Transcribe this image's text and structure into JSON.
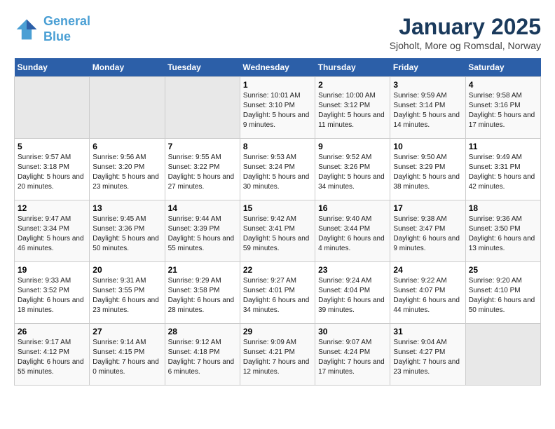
{
  "header": {
    "logo_line1": "General",
    "logo_line2": "Blue",
    "title": "January 2025",
    "subtitle": "Sjoholt, More og Romsdal, Norway"
  },
  "weekdays": [
    "Sunday",
    "Monday",
    "Tuesday",
    "Wednesday",
    "Thursday",
    "Friday",
    "Saturday"
  ],
  "weeks": [
    [
      {
        "day": "",
        "info": ""
      },
      {
        "day": "",
        "info": ""
      },
      {
        "day": "",
        "info": ""
      },
      {
        "day": "1",
        "info": "Sunrise: 10:01 AM\nSunset: 3:10 PM\nDaylight: 5 hours and 9 minutes."
      },
      {
        "day": "2",
        "info": "Sunrise: 10:00 AM\nSunset: 3:12 PM\nDaylight: 5 hours and 11 minutes."
      },
      {
        "day": "3",
        "info": "Sunrise: 9:59 AM\nSunset: 3:14 PM\nDaylight: 5 hours and 14 minutes."
      },
      {
        "day": "4",
        "info": "Sunrise: 9:58 AM\nSunset: 3:16 PM\nDaylight: 5 hours and 17 minutes."
      }
    ],
    [
      {
        "day": "5",
        "info": "Sunrise: 9:57 AM\nSunset: 3:18 PM\nDaylight: 5 hours and 20 minutes."
      },
      {
        "day": "6",
        "info": "Sunrise: 9:56 AM\nSunset: 3:20 PM\nDaylight: 5 hours and 23 minutes."
      },
      {
        "day": "7",
        "info": "Sunrise: 9:55 AM\nSunset: 3:22 PM\nDaylight: 5 hours and 27 minutes."
      },
      {
        "day": "8",
        "info": "Sunrise: 9:53 AM\nSunset: 3:24 PM\nDaylight: 5 hours and 30 minutes."
      },
      {
        "day": "9",
        "info": "Sunrise: 9:52 AM\nSunset: 3:26 PM\nDaylight: 5 hours and 34 minutes."
      },
      {
        "day": "10",
        "info": "Sunrise: 9:50 AM\nSunset: 3:29 PM\nDaylight: 5 hours and 38 minutes."
      },
      {
        "day": "11",
        "info": "Sunrise: 9:49 AM\nSunset: 3:31 PM\nDaylight: 5 hours and 42 minutes."
      }
    ],
    [
      {
        "day": "12",
        "info": "Sunrise: 9:47 AM\nSunset: 3:34 PM\nDaylight: 5 hours and 46 minutes."
      },
      {
        "day": "13",
        "info": "Sunrise: 9:45 AM\nSunset: 3:36 PM\nDaylight: 5 hours and 50 minutes."
      },
      {
        "day": "14",
        "info": "Sunrise: 9:44 AM\nSunset: 3:39 PM\nDaylight: 5 hours and 55 minutes."
      },
      {
        "day": "15",
        "info": "Sunrise: 9:42 AM\nSunset: 3:41 PM\nDaylight: 5 hours and 59 minutes."
      },
      {
        "day": "16",
        "info": "Sunrise: 9:40 AM\nSunset: 3:44 PM\nDaylight: 6 hours and 4 minutes."
      },
      {
        "day": "17",
        "info": "Sunrise: 9:38 AM\nSunset: 3:47 PM\nDaylight: 6 hours and 9 minutes."
      },
      {
        "day": "18",
        "info": "Sunrise: 9:36 AM\nSunset: 3:50 PM\nDaylight: 6 hours and 13 minutes."
      }
    ],
    [
      {
        "day": "19",
        "info": "Sunrise: 9:33 AM\nSunset: 3:52 PM\nDaylight: 6 hours and 18 minutes."
      },
      {
        "day": "20",
        "info": "Sunrise: 9:31 AM\nSunset: 3:55 PM\nDaylight: 6 hours and 23 minutes."
      },
      {
        "day": "21",
        "info": "Sunrise: 9:29 AM\nSunset: 3:58 PM\nDaylight: 6 hours and 28 minutes."
      },
      {
        "day": "22",
        "info": "Sunrise: 9:27 AM\nSunset: 4:01 PM\nDaylight: 6 hours and 34 minutes."
      },
      {
        "day": "23",
        "info": "Sunrise: 9:24 AM\nSunset: 4:04 PM\nDaylight: 6 hours and 39 minutes."
      },
      {
        "day": "24",
        "info": "Sunrise: 9:22 AM\nSunset: 4:07 PM\nDaylight: 6 hours and 44 minutes."
      },
      {
        "day": "25",
        "info": "Sunrise: 9:20 AM\nSunset: 4:10 PM\nDaylight: 6 hours and 50 minutes."
      }
    ],
    [
      {
        "day": "26",
        "info": "Sunrise: 9:17 AM\nSunset: 4:12 PM\nDaylight: 6 hours and 55 minutes."
      },
      {
        "day": "27",
        "info": "Sunrise: 9:14 AM\nSunset: 4:15 PM\nDaylight: 7 hours and 0 minutes."
      },
      {
        "day": "28",
        "info": "Sunrise: 9:12 AM\nSunset: 4:18 PM\nDaylight: 7 hours and 6 minutes."
      },
      {
        "day": "29",
        "info": "Sunrise: 9:09 AM\nSunset: 4:21 PM\nDaylight: 7 hours and 12 minutes."
      },
      {
        "day": "30",
        "info": "Sunrise: 9:07 AM\nSunset: 4:24 PM\nDaylight: 7 hours and 17 minutes."
      },
      {
        "day": "31",
        "info": "Sunrise: 9:04 AM\nSunset: 4:27 PM\nDaylight: 7 hours and 23 minutes."
      },
      {
        "day": "",
        "info": ""
      }
    ]
  ]
}
